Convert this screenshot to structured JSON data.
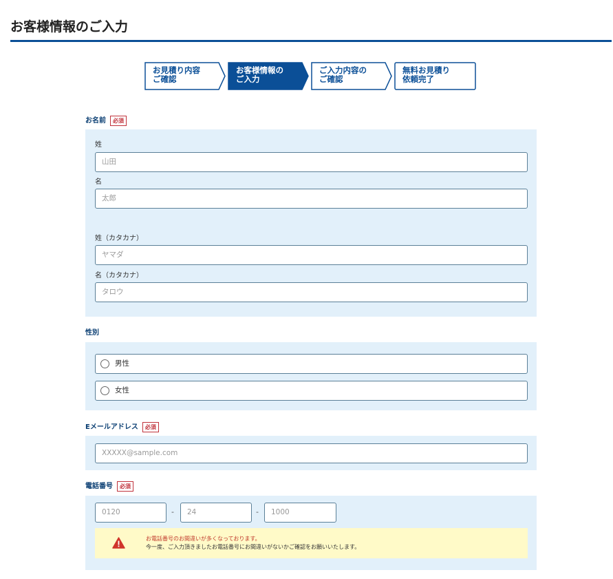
{
  "page_title": "お客様情報のご入力",
  "steps": [
    {
      "label": "お見積り内容\nご確認",
      "active": false
    },
    {
      "label": "お客様情報の\nご入力",
      "active": true
    },
    {
      "label": "ご入力内容の\nご確認",
      "active": false
    },
    {
      "label": "無料お見積り\n依頼完了",
      "active": false
    }
  ],
  "required_badge": "必須",
  "name": {
    "label": "お名前",
    "sei_label": "姓",
    "sei_placeholder": "山田",
    "mei_label": "名",
    "mei_placeholder": "太郎",
    "sei_kana_label": "姓（カタカナ）",
    "sei_kana_placeholder": "ヤマダ",
    "mei_kana_label": "名（カタカナ）",
    "mei_kana_placeholder": "タロウ"
  },
  "gender": {
    "label": "性別",
    "options": [
      "男性",
      "女性"
    ]
  },
  "email": {
    "label": "Eメールアドレス",
    "placeholder": "XXXXX@sample.com"
  },
  "phone": {
    "label": "電話番号",
    "placeholders": [
      "0120",
      "24",
      "1000"
    ],
    "separator": "-",
    "warning_line1": "お電話番号のお間違いが多くなっております。",
    "warning_line2": "今一度、ご入力頂きましたお電話番号にお間違いがないかご確認をお願いいたします。"
  }
}
